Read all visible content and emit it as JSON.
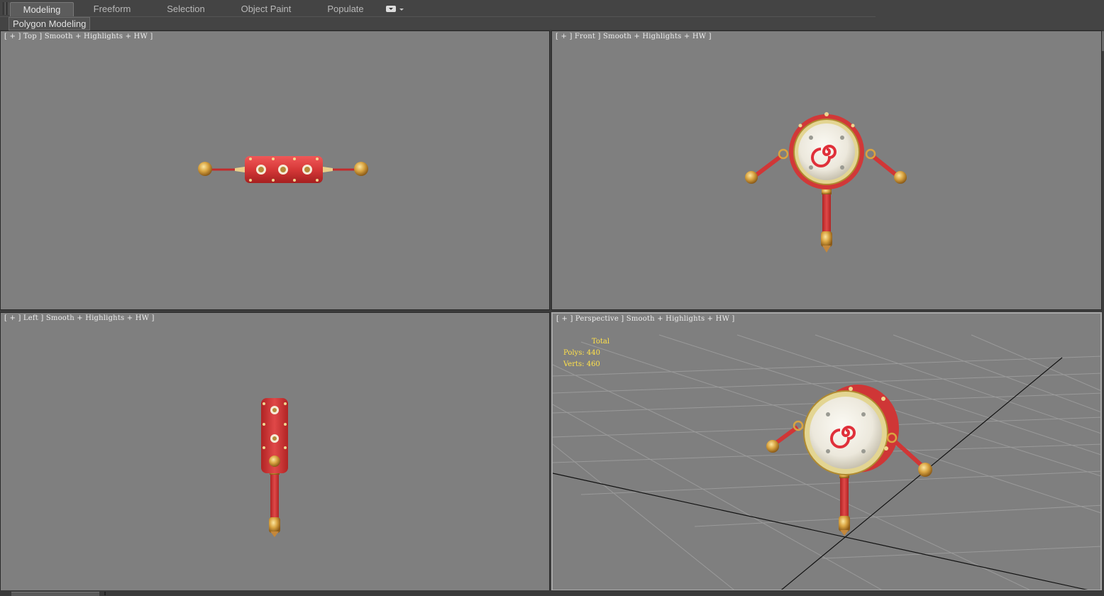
{
  "ribbon": {
    "tabs": [
      {
        "label": "Modeling",
        "active": true
      },
      {
        "label": "Freeform",
        "active": false
      },
      {
        "label": "Selection",
        "active": false
      },
      {
        "label": "Object Paint",
        "active": false
      },
      {
        "label": "Populate",
        "active": false
      }
    ],
    "dropdown_icon": "ribbon-options-icon",
    "panel_label": "Polygon Modeling"
  },
  "viewports": {
    "top": {
      "label": "[ + ] Top ] Smooth + Highlights + HW ]"
    },
    "front": {
      "label": "[ + ] Front ] Smooth + Highlights + HW ]"
    },
    "left": {
      "label": "[ + ] Left ] Smooth + Highlights + HW ]"
    },
    "perspective": {
      "label": "[ + ] Perspective ] Smooth + Highlights + HW ]",
      "stats": {
        "title": "Total",
        "polys": "Polys: 440",
        "verts": "Verts: 460"
      }
    }
  },
  "colors": {
    "viewport_bg": "#7f7f7f",
    "drum_red": "#d63838",
    "gold": "#d9a441",
    "stats_text": "#ffe14a"
  }
}
